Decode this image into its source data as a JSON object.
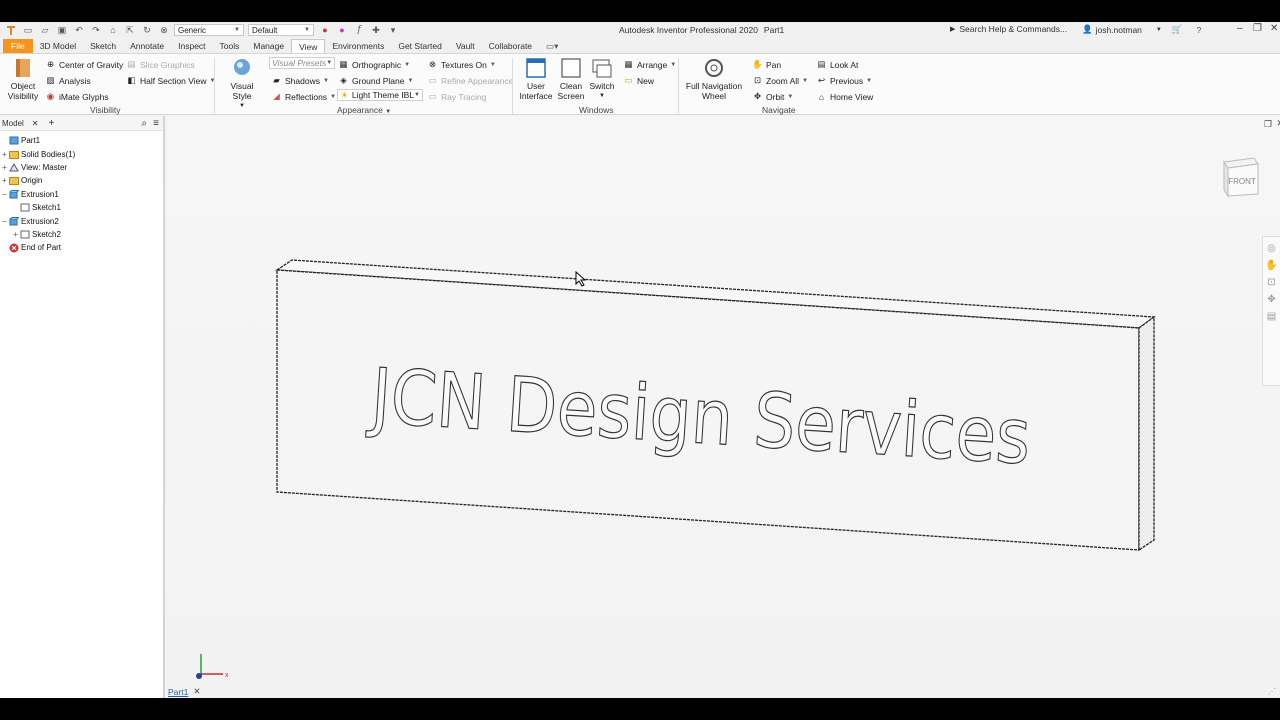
{
  "window": {
    "app_title": "Autodesk Inventor Professional 2020",
    "doc_title": "Part1"
  },
  "qat": {
    "material": "Generic",
    "appearance": "Default"
  },
  "help": {
    "search_placeholder": "Search Help & Commands..."
  },
  "user": {
    "name": "josh.notman"
  },
  "tabs": [
    "File",
    "3D Model",
    "Sketch",
    "Annotate",
    "Inspect",
    "Tools",
    "Manage",
    "View",
    "Environments",
    "Get Started",
    "Vault",
    "Collaborate"
  ],
  "ribbon": {
    "visibility": {
      "title": "Visibility",
      "object_visibility": [
        "Object",
        "Visibility"
      ],
      "center_of_gravity": "Center of Gravity",
      "slice_graphics": "Slice Graphics",
      "analysis": "Analysis",
      "half_section_view": "Half Section View",
      "imate_glyphs": "iMate Glyphs"
    },
    "appearance": {
      "title": "Appearance",
      "visual_style": "Visual Style",
      "visual_presets": "Visual Presets",
      "orthographic": "Orthographic",
      "textures_on": "Textures On",
      "shadows": "Shadows",
      "ground_plane": "Ground Plane",
      "refine_appearance": "Refine Appearance",
      "reflections": "Reflections",
      "light_theme": "Light Theme IBL",
      "ray_tracing": "Ray Tracing"
    },
    "windows": {
      "title": "Windows",
      "user_interface": [
        "User",
        "Interface"
      ],
      "clean_screen": [
        "Clean",
        "Screen"
      ],
      "switch": "Switch",
      "arrange": "Arrange",
      "new": "New"
    },
    "navigate": {
      "title": "Navigate",
      "full_nav_wheel": [
        "Full Navigation",
        "Wheel"
      ],
      "pan": "Pan",
      "zoom_all": "Zoom All",
      "orbit": "Orbit",
      "look_at": "Look At",
      "previous": "Previous",
      "home_view": "Home View"
    }
  },
  "browser": {
    "tab_label": "Model",
    "tree": [
      {
        "label": "Part1",
        "level": 0,
        "expander": "",
        "icon": "part-icon"
      },
      {
        "label": "Solid Bodies(1)",
        "level": 1,
        "expander": "+",
        "icon": "folder-icon"
      },
      {
        "label": "View: Master",
        "level": 1,
        "expander": "+",
        "icon": "view-icon"
      },
      {
        "label": "Origin",
        "level": 1,
        "expander": "+",
        "icon": "folder-icon"
      },
      {
        "label": "Extrusion1",
        "level": 1,
        "expander": "−",
        "icon": "extrusion-icon"
      },
      {
        "label": "Sketch1",
        "level": 2,
        "expander": "",
        "icon": "sketch-icon"
      },
      {
        "label": "Extrusion2",
        "level": 1,
        "expander": "−",
        "icon": "extrusion-icon"
      },
      {
        "label": "Sketch2",
        "level": 2,
        "expander": "+",
        "icon": "sketch-icon"
      },
      {
        "label": "End of Part",
        "level": 1,
        "expander": "",
        "icon": "end-of-part-icon"
      }
    ]
  },
  "document_tab": {
    "label": "Part1"
  },
  "model": {
    "text": "JCN Design Services"
  },
  "viewcube": {
    "face": "FRONT"
  },
  "colors": {
    "file_tab": "#f7941d",
    "accent": "#2266aa"
  }
}
